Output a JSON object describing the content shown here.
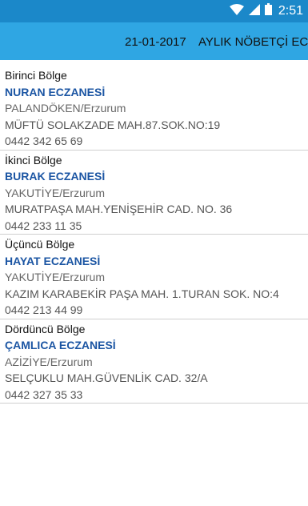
{
  "status_bar": {
    "time": "2:51"
  },
  "toolbar": {
    "date": "21-01-2017",
    "title": "AYLIK NÖBETÇİ ECZA"
  },
  "pharmacies": [
    {
      "region": "Birinci Bölge",
      "name": "NURAN ECZANESİ",
      "district": "PALANDÖKEN/Erzurum",
      "address": "MÜFTÜ SOLAKZADE MAH.87.SOK.NO:19",
      "phone": "0442 342 65 69"
    },
    {
      "region": "İkinci Bölge",
      "name": "BURAK ECZANESİ",
      "district": "YAKUTİYE/Erzurum",
      "address": "MURATPAŞA MAH.YENİŞEHİR CAD. NO. 36",
      "phone": "0442 233 11 35"
    },
    {
      "region": "Üçüncü Bölge",
      "name": "HAYAT ECZANESİ",
      "district": "YAKUTİYE/Erzurum",
      "address": "KAZIM KARABEKİR PAŞA MAH. 1.TURAN SOK. NO:4",
      "phone": "0442 213 44 99"
    },
    {
      "region": "Dördüncü Bölge",
      "name": "ÇAMLICA ECZANESİ",
      "district": "AZİZİYE/Erzurum",
      "address": "SELÇUKLU MAH.GÜVENLİK CAD. 32/A",
      "phone": "0442 327 35 33"
    }
  ]
}
